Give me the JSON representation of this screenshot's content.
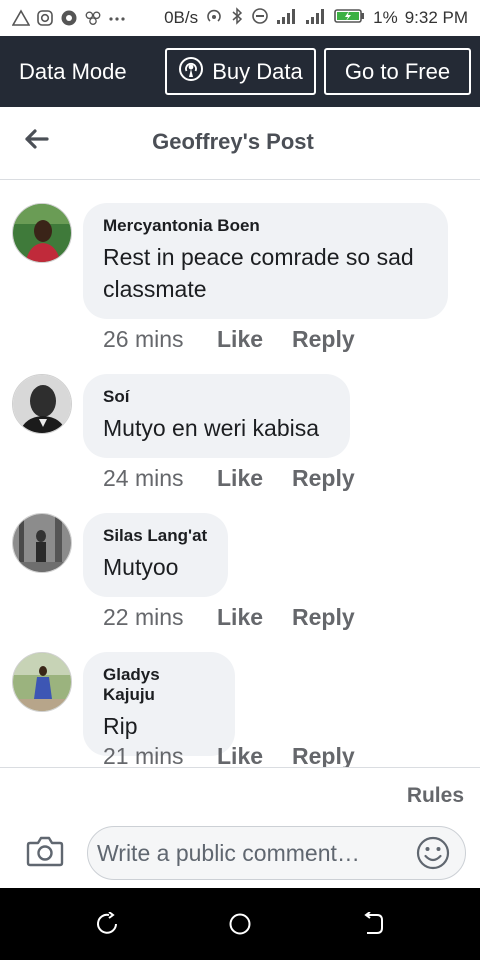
{
  "status_bar": {
    "speed": "0B/s",
    "battery_percent": "1%",
    "time": "9:32 PM",
    "icons": [
      "alert-icon",
      "instagram-icon",
      "chrome-icon",
      "app-icon",
      "more-notifications-icon",
      "hotspot-icon",
      "bluetooth-icon",
      "dnd-icon",
      "signal-icon",
      "signal-4g-icon",
      "battery-charging-icon"
    ]
  },
  "data_bar": {
    "label": "Data Mode",
    "buy_label": "Buy Data",
    "free_label": "Go to Free"
  },
  "header": {
    "title": "Geoffrey's Post"
  },
  "comments": [
    {
      "author": "Mercyantonia Boen",
      "text": "Rest in peace comrade so sad classmate",
      "time": "26 mins",
      "like": "Like",
      "reply": "Reply"
    },
    {
      "author": "Soí",
      "text": "Mutyo en weri kabisa",
      "time": "24 mins",
      "like": "Like",
      "reply": "Reply"
    },
    {
      "author": "Silas Lang'at",
      "text": "Mutyoo",
      "time": "22 mins",
      "like": "Like",
      "reply": "Reply"
    },
    {
      "author": "Gladys Kajuju",
      "text": "Rip",
      "time": "21 mins",
      "like": "Like",
      "reply": "Reply"
    }
  ],
  "footer": {
    "rules": "Rules",
    "placeholder": "Write a public comment…"
  },
  "colors": {
    "data_bar_bg": "#242a35",
    "bubble_bg": "#f0f2f5",
    "meta_text": "#65676b",
    "navbar_bg": "#000000"
  }
}
